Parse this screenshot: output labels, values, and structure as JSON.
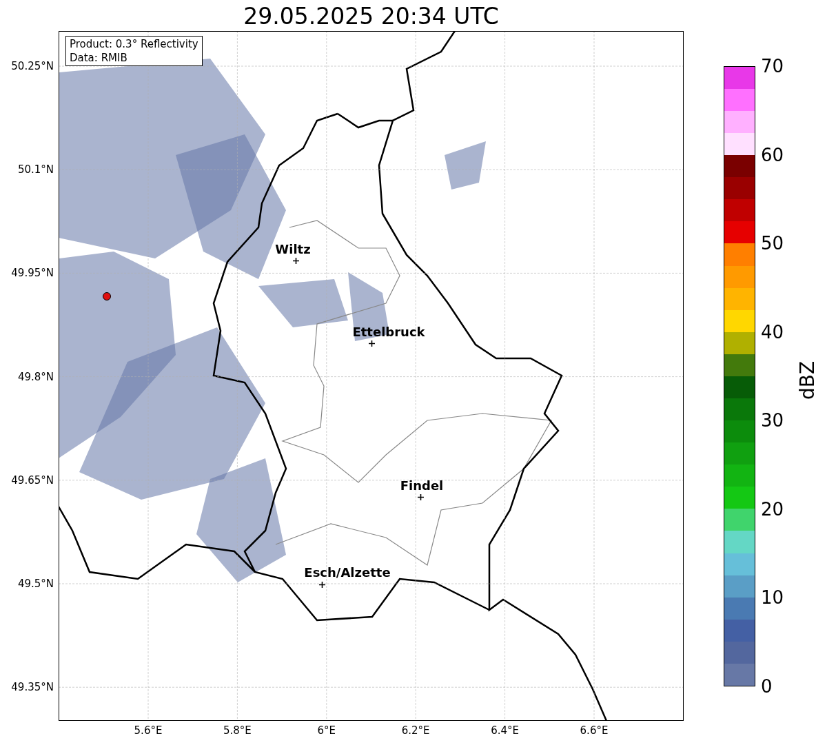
{
  "title": "29.05.2025 20:34 UTC",
  "info_box": {
    "lines": [
      "Product: 0.3° Reflectivity",
      "Data: RMIB"
    ]
  },
  "map": {
    "cities": [
      {
        "name": "Wiltz"
      },
      {
        "name": "Ettelbruck"
      },
      {
        "name": "Findel"
      },
      {
        "name": "Esch/Alzette"
      }
    ]
  },
  "axes": {
    "yticks": [
      "50.25°N",
      "50.1°N",
      "49.95°N",
      "49.8°N",
      "49.65°N",
      "49.5°N",
      "49.35°N"
    ],
    "xticks": [
      "5.6°E",
      "5.8°E",
      "6°E",
      "6.2°E",
      "6.4°E",
      "6.6°E"
    ]
  },
  "colorbar": {
    "label": "dBZ",
    "ticks": [
      "70",
      "60",
      "50",
      "40",
      "30",
      "20",
      "10",
      "0"
    ],
    "segments": [
      {
        "color": "#6778a6"
      },
      {
        "color": "#53679e"
      },
      {
        "color": "#4460a4"
      },
      {
        "color": "#4a7ab2"
      },
      {
        "color": "#5a9ec6"
      },
      {
        "color": "#66bfd9"
      },
      {
        "color": "#64d7c5"
      },
      {
        "color": "#40d46c"
      },
      {
        "color": "#14c814"
      },
      {
        "color": "#12b412"
      },
      {
        "color": "#10a010"
      },
      {
        "color": "#0c8c0c"
      },
      {
        "color": "#0a780a"
      },
      {
        "color": "#075c07"
      },
      {
        "color": "#437a0c"
      },
      {
        "color": "#b0b000"
      },
      {
        "color": "#ffd700"
      },
      {
        "color": "#ffb400"
      },
      {
        "color": "#ff9a00"
      },
      {
        "color": "#ff7f00"
      },
      {
        "color": "#e60000"
      },
      {
        "color": "#c00000"
      },
      {
        "color": "#9a0000"
      },
      {
        "color": "#7a0000"
      },
      {
        "color": "#ffe0ff"
      },
      {
        "color": "#ffb0ff"
      },
      {
        "color": "#ff70ff"
      },
      {
        "color": "#e838e8"
      }
    ]
  }
}
